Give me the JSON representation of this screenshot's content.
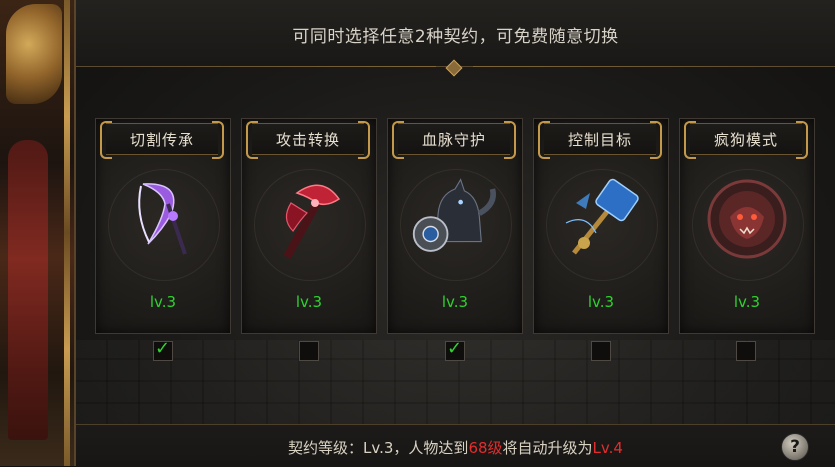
{
  "header": {
    "instruction": "可同时选择任意2种契约，可免费随意切换"
  },
  "cards": [
    {
      "title": "切割传承",
      "level": "lv.3",
      "checked": true,
      "icon": "purple-scythe-icon",
      "accent": "#8b3fd6"
    },
    {
      "title": "攻击转换",
      "level": "lv.3",
      "checked": false,
      "icon": "red-axe-icon",
      "accent": "#c0203a"
    },
    {
      "title": "血脉守护",
      "level": "lv.3",
      "checked": true,
      "icon": "wolf-shield-icon",
      "accent": "#7f8aa0"
    },
    {
      "title": "控制目标",
      "level": "lv.3",
      "checked": false,
      "icon": "blue-hammer-icon",
      "accent": "#3a8ad8"
    },
    {
      "title": "疯狗模式",
      "level": "lv.3",
      "checked": false,
      "icon": "mad-dog-icon",
      "accent": "#b03030"
    }
  ],
  "checkmark": "✓",
  "footer": {
    "prefix": "契约等级：Lv.3，人物达到",
    "target_level": "68级",
    "middle": "将自动升级为",
    "next_level": "Lv.4"
  },
  "help": "?"
}
